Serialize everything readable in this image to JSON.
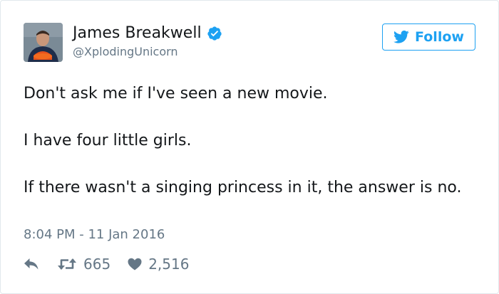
{
  "author": {
    "display_name": "James Breakwell",
    "handle": "@XplodingUnicorn",
    "verified_icon": "verified-badge-icon",
    "avatar_icon": "profile-photo"
  },
  "follow_button": {
    "label": "Follow",
    "icon": "twitter-bird-icon"
  },
  "tweet": {
    "paragraphs": [
      "Don't ask me if I've seen a new movie.",
      "I have four little girls.",
      "If there wasn't a singing princess in it, the answer is no."
    ],
    "timestamp": "8:04 PM - 11 Jan 2016"
  },
  "actions": {
    "reply_icon": "reply-icon",
    "retweet_icon": "retweet-icon",
    "retweet_count": "665",
    "like_icon": "heart-icon",
    "like_count": "2,516"
  },
  "colors": {
    "accent": "#1da1f2",
    "text": "#14171a",
    "secondary": "#657786",
    "border": "#e1e8ed"
  }
}
